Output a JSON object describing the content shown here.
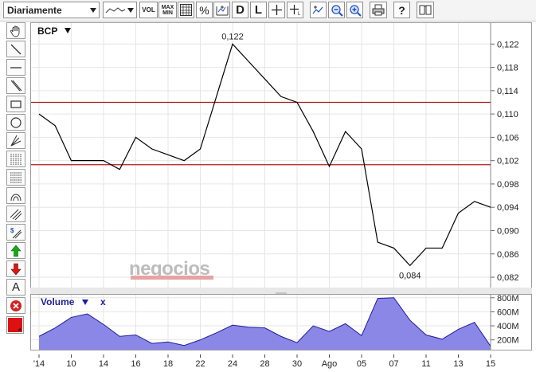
{
  "toolbar": {
    "period": "Diariamente",
    "vol": "VOL",
    "max": "MAX",
    "min": "MIN",
    "percent": "%",
    "d": "D",
    "l": "L"
  },
  "watermark": "negocios",
  "chart_data": [
    {
      "type": "line",
      "title": "BCP",
      "series": [
        {
          "name": "BCP",
          "values": [
            0.11,
            0.108,
            0.102,
            0.102,
            0.102,
            0.1005,
            0.106,
            0.104,
            0.103,
            0.102,
            0.104,
            0.113,
            0.122,
            0.119,
            0.116,
            0.113,
            0.112,
            0.107,
            0.101,
            0.107,
            0.104,
            0.088,
            0.087,
            0.084,
            0.087,
            0.087,
            0.093,
            0.095,
            0.094
          ]
        }
      ],
      "x_tick_labels": [
        "'14",
        "10",
        "14",
        "16",
        "18",
        "22",
        "24",
        "28",
        "30",
        "Ago",
        "05",
        "07",
        "11",
        "13",
        "15"
      ],
      "y_ticks": [
        "0,082",
        "0,086",
        "0,090",
        "0,094",
        "0,098",
        "0,102",
        "0,106",
        "0,110",
        "0,114",
        "0,118",
        "0,122"
      ],
      "ylim": [
        0.0805,
        0.1245
      ],
      "reference_lines": [
        0.112,
        0.1013
      ],
      "annotations": [
        {
          "label": "0,122",
          "value": 0.122,
          "index": 12
        },
        {
          "label": "0,084",
          "value": 0.084,
          "index": 23
        }
      ],
      "grid": true,
      "line_color": "#000000",
      "reference_color": "#b21818"
    },
    {
      "type": "area",
      "title": "Volume",
      "close_label": "x",
      "series": [
        {
          "name": "Volume",
          "values": [
            250,
            370,
            520,
            570,
            420,
            250,
            270,
            150,
            170,
            120,
            200,
            300,
            410,
            380,
            370,
            250,
            160,
            400,
            320,
            430,
            260,
            790,
            800,
            480,
            270,
            210,
            350,
            450,
            110
          ]
        }
      ],
      "y_ticks": [
        "200M",
        "400M",
        "600M",
        "800M"
      ],
      "ylim": [
        60,
        820
      ],
      "fill_color": "#8a87e6",
      "stroke_color": "#1f1f9a",
      "title_color": "#1f1f9a"
    }
  ]
}
